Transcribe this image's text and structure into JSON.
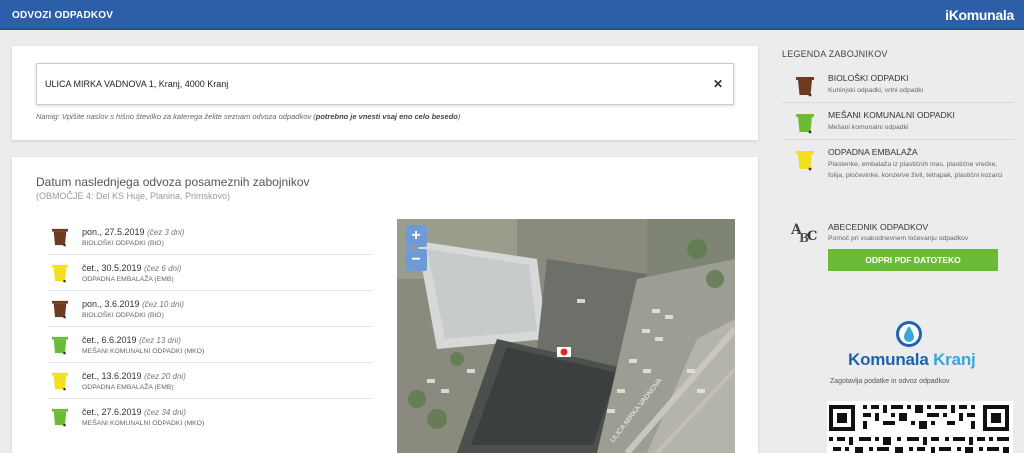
{
  "header": {
    "title": "ODVOZI ODPADKOV",
    "brand": "iKomunala"
  },
  "search": {
    "value": "ULICA MIRKA VADNOVA 1, Kranj, 4000 Kranj",
    "hint_prefix": "Namig: Vpišite naslov s hišno številko za katerega želite seznam odvoza odpadkov (",
    "hint_bold": "potrebno je vnesti vsaj eno celo besedo",
    "hint_suffix": ")"
  },
  "schedule": {
    "title": "Datum naslednjega odvoza posameznih zabojnikov",
    "subtitle": "(OBMOČJE 4: Del KS Huje, Planina, Primskovo)",
    "items": [
      {
        "date": "pon., 27.5.2019",
        "relative": "(čez 3 dni)",
        "type": "BIOLOŠKI ODPADKI (BIO)",
        "color": "#6b3a1f"
      },
      {
        "date": "čet., 30.5.2019",
        "relative": "(čez 6 dni)",
        "type": "ODPADNA EMBALAŽA (EMB)",
        "color": "#f2e020"
      },
      {
        "date": "pon., 3.6.2019",
        "relative": "(čez 10 dni)",
        "type": "BIOLOŠKI ODPADKI (BIO)",
        "color": "#6b3a1f"
      },
      {
        "date": "čet., 6.6.2019",
        "relative": "(čez 13 dni)",
        "type": "MEŠANI KOMUNALNI ODPADKI (MKO)",
        "color": "#6cbb36"
      },
      {
        "date": "čet., 13.6.2019",
        "relative": "(čez 20 dni)",
        "type": "ODPADNA EMBALAŽA (EMB)",
        "color": "#f2e020"
      },
      {
        "date": "čet., 27.6.2019",
        "relative": "(čez 34 dni)",
        "type": "MEŠANI KOMUNALNI ODPADKI (MKO)",
        "color": "#6cbb36"
      }
    ]
  },
  "map": {
    "zoom_in": "+",
    "zoom_out": "−",
    "street_label": "ULICA MIRKA VADNOVA"
  },
  "legend": {
    "title": "LEGENDA ZABOJNIKOV",
    "items": [
      {
        "title": "BIOLOŠKI ODPADKI",
        "desc": "Kuhinjski odpadki, vrtni odpadki",
        "color": "#6b3a1f"
      },
      {
        "title": "MEŠANI KOMUNALNI ODPADKI",
        "desc": "Mešani komunalni odpadki",
        "color": "#6cbb36"
      },
      {
        "title": "ODPADNA EMBALAŽA",
        "desc": "Plastenke, embalaža iz plastičnih mas, plastične vrečke, folija, pločevinke, konzerve živil, tetrapak, plastični kozarci",
        "color": "#f2e020"
      }
    ]
  },
  "abecednik": {
    "title": "ABECEDNIK ODPADKOV",
    "desc": "Pomoč pri vsakodnevnem ločevanju odpadkov",
    "button": "ODPRI PDF DATOTEKO"
  },
  "provider": {
    "name_part1": "Komunala",
    "name_part2": "Kranj",
    "subtitle": "Zagotavlja podatke in odvoz odpadkov"
  },
  "colors": {
    "header": "#2d5ea8",
    "accent_green": "#6cbb36",
    "bio_brown": "#6b3a1f",
    "emb_yellow": "#f2e020"
  }
}
